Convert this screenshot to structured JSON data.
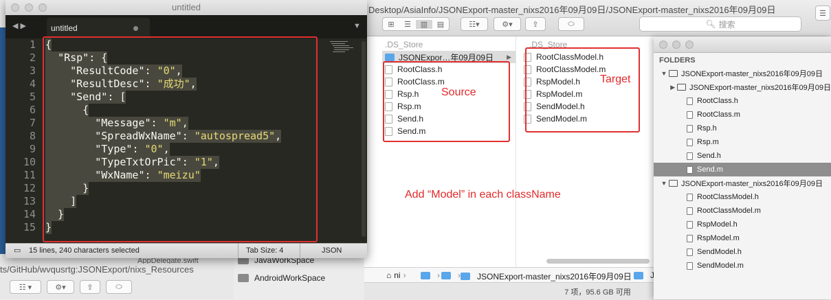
{
  "editor": {
    "window_title": "untitled",
    "tab_label": "untitled",
    "line_numbers": [
      "1",
      "2",
      "3",
      "4",
      "5",
      "6",
      "7",
      "8",
      "9",
      "10",
      "11",
      "12",
      "13",
      "14",
      "15"
    ],
    "code_lines": [
      "{",
      "  \"Rsp\": {",
      "    \"ResultCode\": \"0\",",
      "    \"ResultDesc\": \"成功\",",
      "    \"Send\": [",
      "      {",
      "        \"Message\": \"m\",",
      "        \"SpreadWxName\": \"autospread5\",",
      "        \"Type\": \"0\",",
      "        \"TypeTxtOrPic\": \"1\",",
      "        \"WxName\": \"meizu\"",
      "      }",
      "    ]",
      "  }",
      "}"
    ],
    "status_selection": "15 lines, 240 characters selected",
    "status_tab_size": "Tab Size: 4",
    "status_syntax": "JSON",
    "nav_arrows": "◀ ▶",
    "dropdown_arrow": "▼"
  },
  "finder": {
    "path_title": "Desktop/AsiaInfo/JSONExport-master_nixs2016年09月09日/JSONExport-master_nixs2016年09月09日",
    "search_placeholder": "搜索",
    "column1": [
      {
        "name": ".DS_Store",
        "kind": "faded"
      },
      {
        "name": "JSONExpor…年09月09日",
        "kind": "folder"
      },
      {
        "name": "RootClass.h",
        "kind": "file"
      },
      {
        "name": "RootClass.m",
        "kind": "file"
      },
      {
        "name": "Rsp.h",
        "kind": "file"
      },
      {
        "name": "Rsp.m",
        "kind": "file"
      },
      {
        "name": "Send.h",
        "kind": "file"
      },
      {
        "name": "Send.m",
        "kind": "file"
      }
    ],
    "column2": [
      {
        "name": ".DS_Store",
        "kind": "faded"
      },
      {
        "name": "RootClassModel.h",
        "kind": "file"
      },
      {
        "name": "RootClassModel.m",
        "kind": "file"
      },
      {
        "name": "RspModel.h",
        "kind": "file"
      },
      {
        "name": "RspModel.m",
        "kind": "file"
      },
      {
        "name": "SendModel.h",
        "kind": "file"
      },
      {
        "name": "SendModel.m",
        "kind": "file"
      }
    ],
    "breadcrumb": [
      "ni",
      "JSONExport-master_nixs2016年09月09日",
      "JS"
    ],
    "status": "7 项，95.6 GB 可用",
    "sidebar_items": [
      "JavaWorkSpace",
      "AndroidWorkSpace"
    ]
  },
  "background_window": {
    "path_text": "ts/GitHub/wvqusrtg:JSONExport/nixs_Resources",
    "partial_file": "AppDelegate.swift"
  },
  "folders_panel": {
    "title": "FOLDERS",
    "items": [
      {
        "label": "JSONExport-master_nixs2016年09月09日",
        "kind": "folder-open",
        "level": 0
      },
      {
        "label": "JSONExport-master_nixs2016年09月09日",
        "kind": "folder-closed",
        "level": 1
      },
      {
        "label": "RootClass.h",
        "kind": "file",
        "level": 1
      },
      {
        "label": "RootClass.m",
        "kind": "file",
        "level": 1
      },
      {
        "label": "Rsp.h",
        "kind": "file",
        "level": 1
      },
      {
        "label": "Rsp.m",
        "kind": "file",
        "level": 1
      },
      {
        "label": "Send.h",
        "kind": "file",
        "level": 1
      },
      {
        "label": "Send.m",
        "kind": "file",
        "level": 1,
        "selected": true
      },
      {
        "label": "JSONExport-master_nixs2016年09月09日",
        "kind": "folder-open",
        "level": 0
      },
      {
        "label": "RootClassModel.h",
        "kind": "file",
        "level": 1
      },
      {
        "label": "RootClassModel.m",
        "kind": "file",
        "level": 1
      },
      {
        "label": "RspModel.h",
        "kind": "file",
        "level": 1
      },
      {
        "label": "RspModel.m",
        "kind": "file",
        "level": 1
      },
      {
        "label": "SendModel.h",
        "kind": "file",
        "level": 1
      },
      {
        "label": "SendModel.m",
        "kind": "file",
        "level": 1
      }
    ]
  },
  "annotations": {
    "source": "Source",
    "target": "Target",
    "note": "Add “Model” in each className",
    "color": "#e02a2a"
  },
  "colors": {
    "editor_bg": "#272822",
    "string": "#e6db74",
    "selection": "#49483e",
    "folder_blue": "#5aa6ea"
  }
}
